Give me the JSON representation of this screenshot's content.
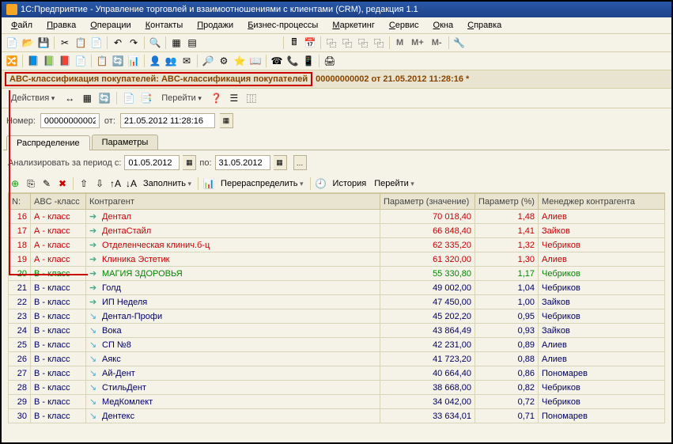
{
  "window": {
    "title": "1С:Предприятие - Управление торговлей и взаимоотношениями с клиентами (CRM), редакция 1.1"
  },
  "menu": {
    "file": "Файл",
    "edit": "Правка",
    "operations": "Операции",
    "contacts": "Контакты",
    "sales": "Продажи",
    "biz": "Бизнес-процессы",
    "marketing": "Маркетинг",
    "service": "Сервис",
    "windows": "Окна",
    "help": "Справка"
  },
  "toolbar_letters": {
    "m": "M",
    "mplus": "M+",
    "mminus": "M-"
  },
  "doc": {
    "title_boxed": "ABC-классификация покупателей: ABC-классификация покупателей",
    "title_rest": "00000000002 от 21.05.2012 11:28:16 *",
    "actions": "Действия",
    "go": "Перейти",
    "number_label": "Номер:",
    "number_value": "00000000002",
    "from_label": "от:",
    "date_value": "21.05.2012 11:28:16"
  },
  "tabs": {
    "t1": "Распределение",
    "t2": "Параметры"
  },
  "period": {
    "label": "Анализировать за период с:",
    "from": "01.05.2012",
    "to_label": "по:",
    "to": "31.05.2012"
  },
  "grid_toolbar": {
    "fill": "Заполнить",
    "redistribute": "Перераспределить",
    "history": "История",
    "go": "Перейти"
  },
  "columns": {
    "n": "N:",
    "abc": "ABC -класс",
    "agent": "Контрагент",
    "param_val": "Параметр (значение)",
    "param_pct": "Параметр (%)",
    "manager": "Менеджер контрагента"
  },
  "rows": [
    {
      "n": "16",
      "abc": "А - класс",
      "agent": "Дентал",
      "val": "70 018,40",
      "pct": "1,48",
      "mgr": "Алиев",
      "cls": "red",
      "icon": "→"
    },
    {
      "n": "17",
      "abc": "А - класс",
      "agent": "ДентаСтайл",
      "val": "66 848,40",
      "pct": "1,41",
      "mgr": "Зайков",
      "cls": "red",
      "icon": "→"
    },
    {
      "n": "18",
      "abc": "А - класс",
      "agent": "Отделенческая клинич.б-ц",
      "val": "62 335,20",
      "pct": "1,32",
      "mgr": "Чебриков",
      "cls": "red",
      "icon": "→"
    },
    {
      "n": "19",
      "abc": "А - класс",
      "agent": "Клиника Эстетик",
      "val": "61 320,00",
      "pct": "1,30",
      "mgr": "Алиев",
      "cls": "red",
      "icon": "→",
      "box": true
    },
    {
      "n": "20",
      "abc": "В - класс",
      "agent": "МАГИЯ ЗДОРОВЬЯ",
      "val": "55 330,80",
      "pct": "1,17",
      "mgr": "Чебриков",
      "cls": "green",
      "icon": "→",
      "box2": true
    },
    {
      "n": "21",
      "abc": "В - класс",
      "agent": "Голд",
      "val": "49 002,00",
      "pct": "1,04",
      "mgr": "Чебриков",
      "cls": "blue",
      "icon": "→"
    },
    {
      "n": "22",
      "abc": "В - класс",
      "agent": "ИП Неделя",
      "val": "47 450,00",
      "pct": "1,00",
      "mgr": "Зайков",
      "cls": "blue",
      "icon": "→"
    },
    {
      "n": "23",
      "abc": "В - класс",
      "agent": "Дентал-Профи",
      "val": "45 202,20",
      "pct": "0,95",
      "mgr": "Чебриков",
      "cls": "blue",
      "icon": "↘"
    },
    {
      "n": "24",
      "abc": "В - класс",
      "agent": "Вока",
      "val": "43 864,49",
      "pct": "0,93",
      "mgr": "Зайков",
      "cls": "blue",
      "icon": "↘"
    },
    {
      "n": "25",
      "abc": "В - класс",
      "agent": "СП №8",
      "val": "42 231,00",
      "pct": "0,89",
      "mgr": "Алиев",
      "cls": "blue",
      "icon": "↘"
    },
    {
      "n": "26",
      "abc": "В - класс",
      "agent": "Аякс",
      "val": "41 723,20",
      "pct": "0,88",
      "mgr": "Алиев",
      "cls": "blue",
      "icon": "↘"
    },
    {
      "n": "27",
      "abc": "В - класс",
      "agent": "Ай-Дент",
      "val": "40 664,40",
      "pct": "0,86",
      "mgr": "Пономарев",
      "cls": "blue",
      "icon": "↘"
    },
    {
      "n": "28",
      "abc": "В - класс",
      "agent": "СтильДент",
      "val": "38 668,00",
      "pct": "0,82",
      "mgr": "Чебриков",
      "cls": "blue",
      "icon": "↘"
    },
    {
      "n": "29",
      "abc": "В - класс",
      "agent": "МедКомлект",
      "val": "34 042,00",
      "pct": "0,72",
      "mgr": "Чебриков",
      "cls": "blue",
      "icon": "↘"
    },
    {
      "n": "30",
      "abc": "В - класс",
      "agent": "Дентекс",
      "val": "33 634,01",
      "pct": "0,71",
      "mgr": "Пономарев",
      "cls": "blue",
      "icon": "↘"
    }
  ]
}
